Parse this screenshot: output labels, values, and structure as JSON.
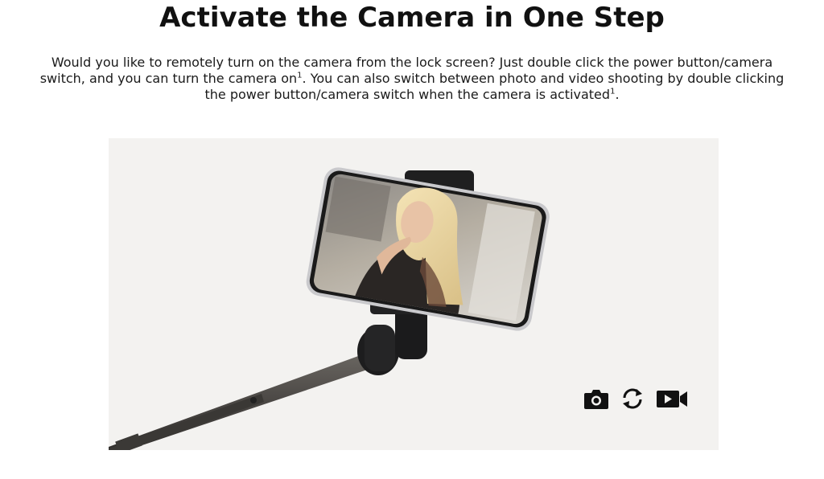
{
  "headline": "Activate the Camera in One Step",
  "description": {
    "part1": "Would you like to remotely turn on the camera from the lock screen? Just double click the power button/camera switch, and you can turn the camera on",
    "sup1": "1",
    "part2": ". You can also switch between photo and video shooting by double clicking the power button/camera switch when the camera is activated",
    "sup2": "1",
    "part3": "."
  },
  "stage": {
    "background": "#f3f2f0",
    "mode_icons": [
      "photo-camera-icon",
      "switch-rotate-icon",
      "video-camera-icon"
    ]
  },
  "colors": {
    "text": "#111111",
    "icon": "#111111",
    "stick": "#4a4744"
  }
}
